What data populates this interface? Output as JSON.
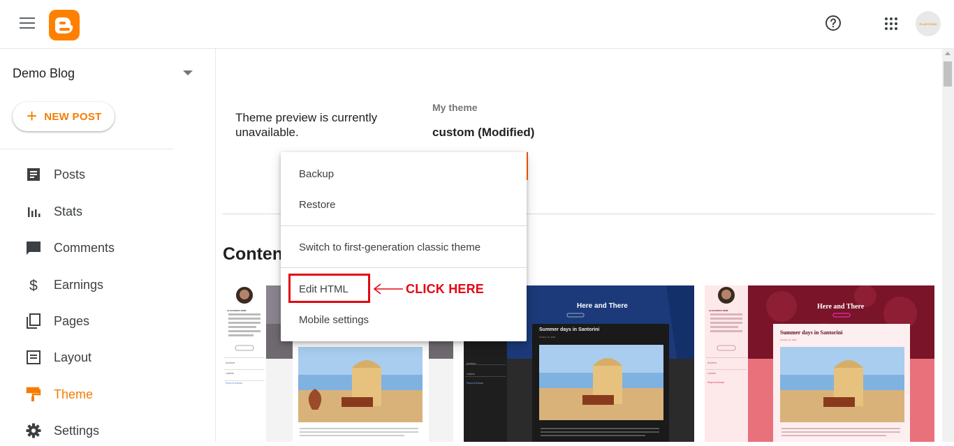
{
  "header": {
    "menu_icon": "hamburger-menu-icon",
    "logo_icon": "blogger-logo-icon",
    "help_icon": "help-circle-icon",
    "apps_icon": "apps-grid-icon",
    "avatar_text": "PLANTIONS",
    "accent": "#ff8000"
  },
  "sidebar": {
    "blog_name": "Demo Blog",
    "new_post_label": "NEW POST",
    "items": [
      {
        "label": "Posts",
        "icon": "posts-icon"
      },
      {
        "label": "Stats",
        "icon": "stats-icon"
      },
      {
        "label": "Comments",
        "icon": "comments-icon"
      },
      {
        "label": "Earnings",
        "icon": "earnings-icon"
      },
      {
        "label": "Pages",
        "icon": "pages-icon"
      },
      {
        "label": "Layout",
        "icon": "layout-icon"
      },
      {
        "label": "Theme",
        "icon": "theme-icon",
        "active": true
      },
      {
        "label": "Settings",
        "icon": "settings-icon"
      }
    ]
  },
  "main": {
    "preview_message": "Theme preview is currently unavailable.",
    "my_theme_label": "My theme",
    "theme_name": "custom (Modified)",
    "content_heading": "Conten"
  },
  "dropdown": {
    "items": [
      "Backup",
      "Restore",
      "Switch to first-generation classic theme",
      "Edit HTML",
      "Mobile settings"
    ]
  },
  "annotation": {
    "text": "CLICK HERE",
    "color": "#e30613"
  },
  "thumbnails": [
    {
      "author": "ALEXANDRA SIMM",
      "sidebar_links": [
        "Archive",
        "Labels"
      ],
      "report": "Report Abuse"
    },
    {
      "title": "Here and There",
      "post_title": "Summer days in Santorini",
      "date": "October 10, 2018",
      "sidebar_links": [
        "Archive",
        "Labels"
      ],
      "report": "Report Abuse"
    },
    {
      "author": "ALEXANDRA SIMM",
      "title": "Here and There",
      "post_title": "Summer days in Santorini",
      "date": "October 10, 2018",
      "sidebar_links": [
        "Archive",
        "Labels"
      ],
      "report": "Report Abuse"
    }
  ]
}
